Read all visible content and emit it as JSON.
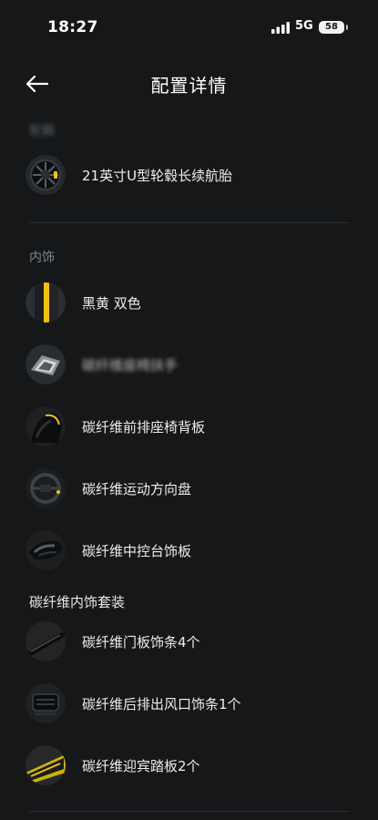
{
  "status_bar": {
    "time": "18:27",
    "network": "5G",
    "battery": "58"
  },
  "header": {
    "title": "配置详情"
  },
  "wheels": {
    "section_label": "轮毂",
    "item_label": "21英寸U型轮毂长续航胎"
  },
  "interior": {
    "section_label": "内饰",
    "items": [
      {
        "label": "黑黄 双色",
        "icon": "black-yellow-seat-swatch"
      },
      {
        "label": "碳纤维座椅扶手",
        "icon": "armrest-thumbnail"
      },
      {
        "label": "碳纤维前排座椅背板",
        "icon": "seatback-thumbnail"
      },
      {
        "label": "碳纤维运动方向盘",
        "icon": "steering-wheel-thumbnail"
      },
      {
        "label": "碳纤维中控台饰板",
        "icon": "console-trim-thumbnail"
      }
    ]
  },
  "carbon_kit": {
    "group_label": "碳纤维内饰套装",
    "items": [
      {
        "label": "碳纤维门板饰条4个",
        "icon": "door-trim-thumbnail"
      },
      {
        "label": "碳纤维后排出风口饰条1个",
        "icon": "vent-trim-thumbnail"
      },
      {
        "label": "碳纤维迎宾踏板2个",
        "icon": "sill-plate-thumbnail"
      }
    ]
  },
  "colors": {
    "background": "#151719",
    "accent_yellow": "#f2c300",
    "divider": "#2a2d30",
    "muted_text": "#7f8489"
  }
}
